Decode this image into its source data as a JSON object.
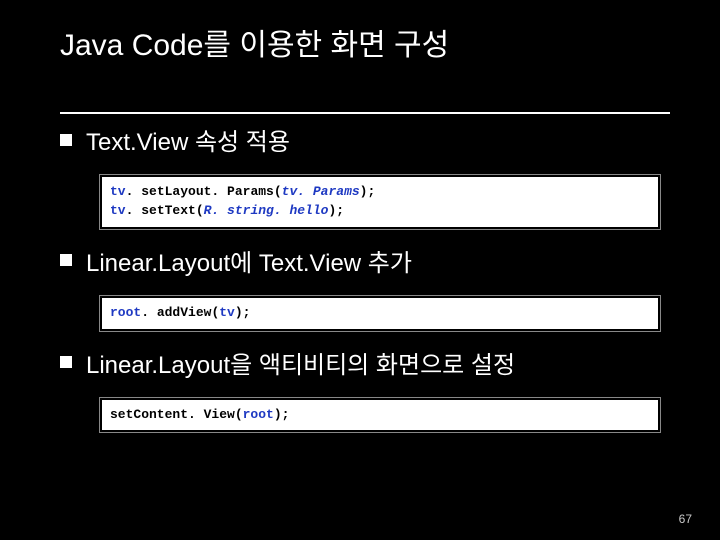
{
  "title": "Java Code를 이용한 화면 구성",
  "bullets": [
    {
      "text": "Text.View 속성 적용"
    },
    {
      "text": "Linear.Layout에 Text.View 추가"
    },
    {
      "text": "Linear.Layout을 액티비티의 화면으로 설정"
    }
  ],
  "code1": {
    "l1a": "tv",
    "l1b": ". set",
    "l1c": "Layout. Params(",
    "l1d": "tv. Params",
    "l1e": ");",
    "l2a": "tv",
    "l2b": ". set",
    "l2c": "Text(",
    "l2d": "R. string. hello",
    "l2e": ");"
  },
  "code2": {
    "l1a": "root",
    "l1b": ". add",
    "l1c": "View(",
    "l1d": "tv",
    "l1e": ");"
  },
  "code3": {
    "l1a": "set",
    "l1b": "Content. View(",
    "l1c": "root",
    "l1d": ");"
  },
  "page_number": "67"
}
